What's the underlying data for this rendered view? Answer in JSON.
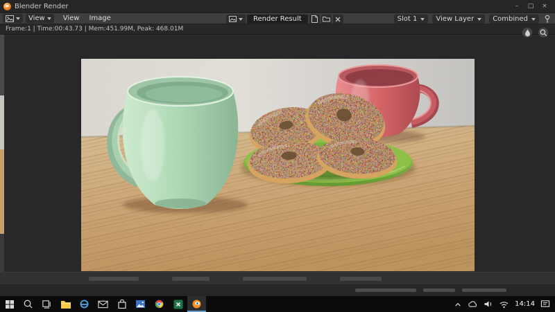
{
  "window": {
    "title": "Blender Render",
    "controls": {
      "minimize": "–",
      "maximize": "□",
      "close": "×"
    }
  },
  "header": {
    "editor_type": "image-editor",
    "mode_dropdown": {
      "value": "View"
    },
    "menus": [
      {
        "label": "View"
      },
      {
        "label": "Image"
      }
    ],
    "datablock": {
      "value": "Render Result"
    },
    "slot_dropdown": {
      "value": "Slot 1"
    },
    "layer_dropdown": {
      "value": "View Layer"
    },
    "pass_dropdown": {
      "value": "Combined"
    }
  },
  "stats_bar": {
    "text": "Frame:1 | Time:00:43.73 | Mem:451.99M, Peak: 468.01M"
  },
  "render_view": {
    "description": "Rendered scene: a mint-green speckled mug and a red mug on a wooden table beside a green plate stacked with four sprinkle-covered donuts, against a grey wall",
    "colors": {
      "green_mug": "#b2dcb8",
      "red_mug": "#d96468",
      "plate": "#7fb63d",
      "donut_dough": "#d8a55f",
      "donut_icing": "#b08878",
      "table_wood": "#cfa878",
      "wall": "#dcd9d4"
    }
  },
  "taskbar": {
    "time": "14:14",
    "icons": [
      {
        "name": "start"
      },
      {
        "name": "search"
      },
      {
        "name": "task-view"
      },
      {
        "name": "file-explorer"
      },
      {
        "name": "edge"
      },
      {
        "name": "mail"
      },
      {
        "name": "store"
      },
      {
        "name": "photos"
      },
      {
        "name": "chrome"
      },
      {
        "name": "excel"
      },
      {
        "name": "blender",
        "active": true
      }
    ],
    "tray_icons": [
      "chevron-up",
      "onedrive",
      "speaker",
      "network",
      "action-center"
    ]
  }
}
